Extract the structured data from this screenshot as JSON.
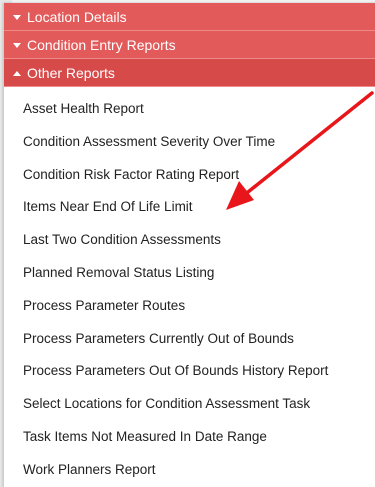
{
  "sections": [
    {
      "label": "Location Details",
      "state": "collapsed"
    },
    {
      "label": "Condition Entry Reports",
      "state": "collapsed"
    },
    {
      "label": "Other Reports",
      "state": "expanded"
    }
  ],
  "reports": [
    {
      "label": "Asset Health Report"
    },
    {
      "label": "Condition Assessment Severity Over Time"
    },
    {
      "label": "Condition Risk Factor Rating Report"
    },
    {
      "label": "Items Near End Of Life Limit"
    },
    {
      "label": "Last Two Condition Assessments"
    },
    {
      "label": "Planned Removal Status Listing"
    },
    {
      "label": "Process Parameter Routes"
    },
    {
      "label": "Process Parameters Currently Out of Bounds"
    },
    {
      "label": "Process Parameters Out Of Bounds History Report"
    },
    {
      "label": "Select Locations for Condition Assessment Task"
    },
    {
      "label": "Task Items Not Measured In Date Range"
    },
    {
      "label": "Work Planners Report"
    }
  ],
  "colors": {
    "header": "#e25a5a",
    "header_active": "#d64a4a",
    "arrow": "#e8161a"
  },
  "annotation": {
    "type": "arrow",
    "points_to": "Items Near End Of Life Limit"
  }
}
